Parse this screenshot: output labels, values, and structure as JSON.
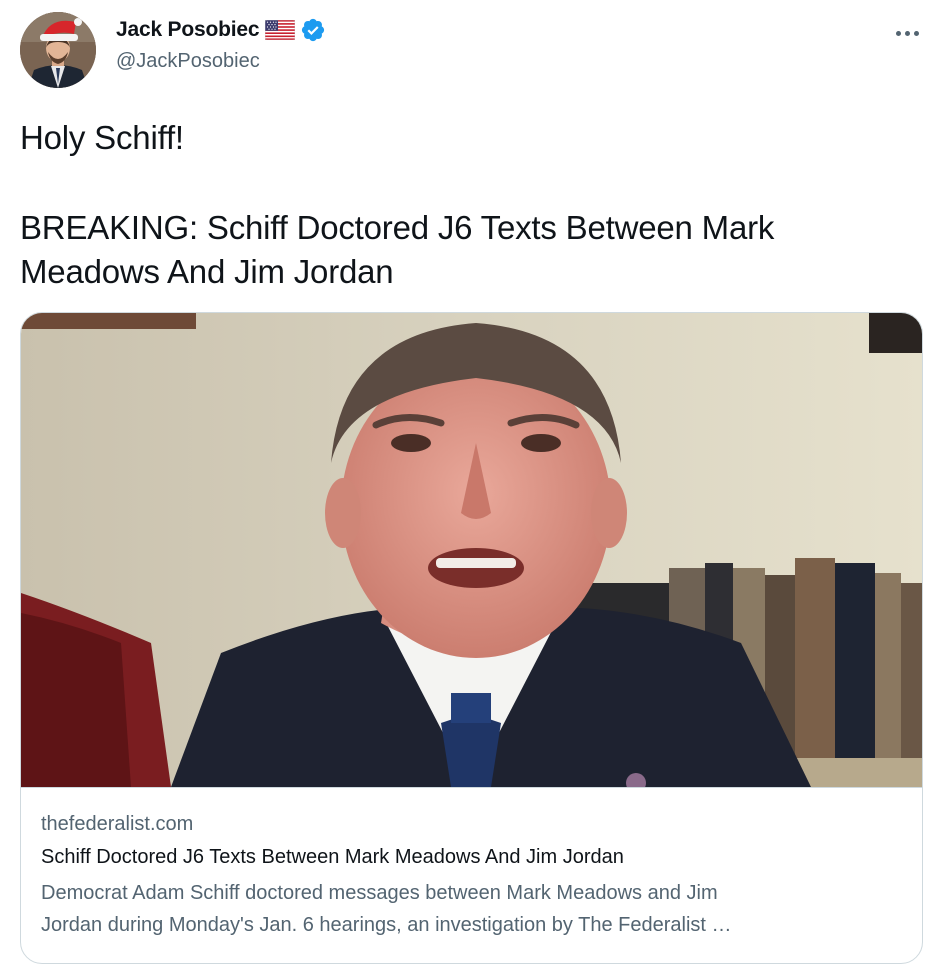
{
  "author": {
    "display_name": "Jack Posobiec",
    "handle": "@JackPosobiec",
    "flag_icon": "us-flag-icon",
    "verified_icon": "verified-badge-icon",
    "verified_color": "#1d9bf0"
  },
  "tweet": {
    "lines": [
      "Holy Schiff!",
      "BREAKING: Schiff Doctored J6 Texts Between Mark",
      "Meadows And Jim Jordan"
    ]
  },
  "card": {
    "domain": "thefederalist.com",
    "title": "Schiff Doctored J6 Texts Between Mark Meadows And Jim Jordan",
    "description_lines": [
      "Democrat Adam Schiff doctored messages between Mark Meadows and Jim",
      "Jordan during Monday's Jan. 6 hearings, an investigation by The Federalist …"
    ]
  },
  "menu": {
    "icon": "more-options-icon"
  }
}
